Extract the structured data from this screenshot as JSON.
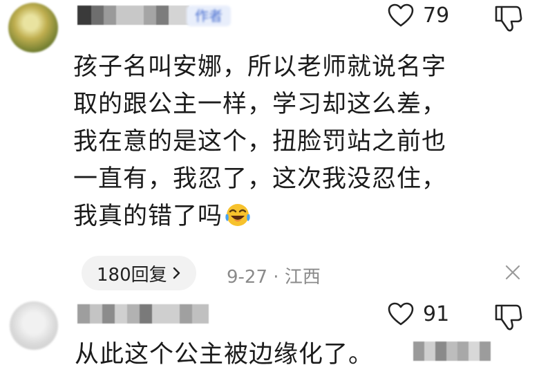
{
  "comments": [
    {
      "author_tag": "作者",
      "likes": "79",
      "lines": [
        "孩子名叫安娜，所以老师就说名字",
        "取的跟公主一样，学习却这么差，",
        "我在意的是这个，扭脸罚站之前也",
        "一直有，我忍了，这次我没忍住，",
        "我真的错了吗"
      ],
      "emoji": "laughing-crying-emoji",
      "replies": "180回复",
      "date": "9-27",
      "separator": "·",
      "location": "江西"
    },
    {
      "likes": "91",
      "text": "从此这个公主被边缘化了。"
    }
  ],
  "icons": {
    "like": "heart-outline-icon",
    "dislike": "thumbs-down-icon",
    "close": "close-icon",
    "chevron": "chevron-right-icon"
  },
  "colors": {
    "author_tag_bg": "#e8eefb",
    "author_tag_text": "#4a6fd0",
    "reply_pill_bg": "#f2f2f2",
    "meta_text": "#8a8a8a"
  }
}
